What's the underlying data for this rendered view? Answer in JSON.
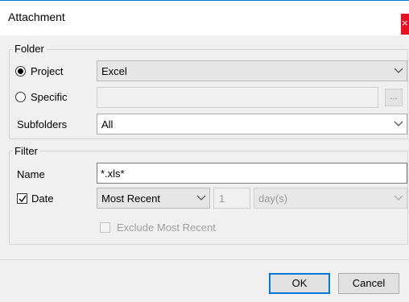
{
  "window": {
    "title": "Attachment",
    "close_glyph": "×"
  },
  "folder": {
    "legend": "Folder",
    "project_label": "Project",
    "project_value": "Excel",
    "project_selected": true,
    "specific_label": "Specific",
    "specific_value": "",
    "browse_label": "...",
    "subfolders_label": "Subfolders",
    "subfolders_value": "All"
  },
  "filter": {
    "legend": "Filter",
    "name_label": "Name",
    "name_value": "*.xls*",
    "date_label": "Date",
    "date_checked": true,
    "date_mode": "Most Recent",
    "count_value": "1",
    "unit_value": "day(s)",
    "exclude_label": "Exclude Most Recent",
    "exclude_checked": false
  },
  "buttons": {
    "ok": "OK",
    "cancel": "Cancel"
  },
  "colors": {
    "accent": "#0078d7",
    "close": "#e81123",
    "background": "#f0f0f0"
  },
  "icons": [
    "close-icon",
    "chevron-down-icon",
    "checkmark-icon"
  ]
}
